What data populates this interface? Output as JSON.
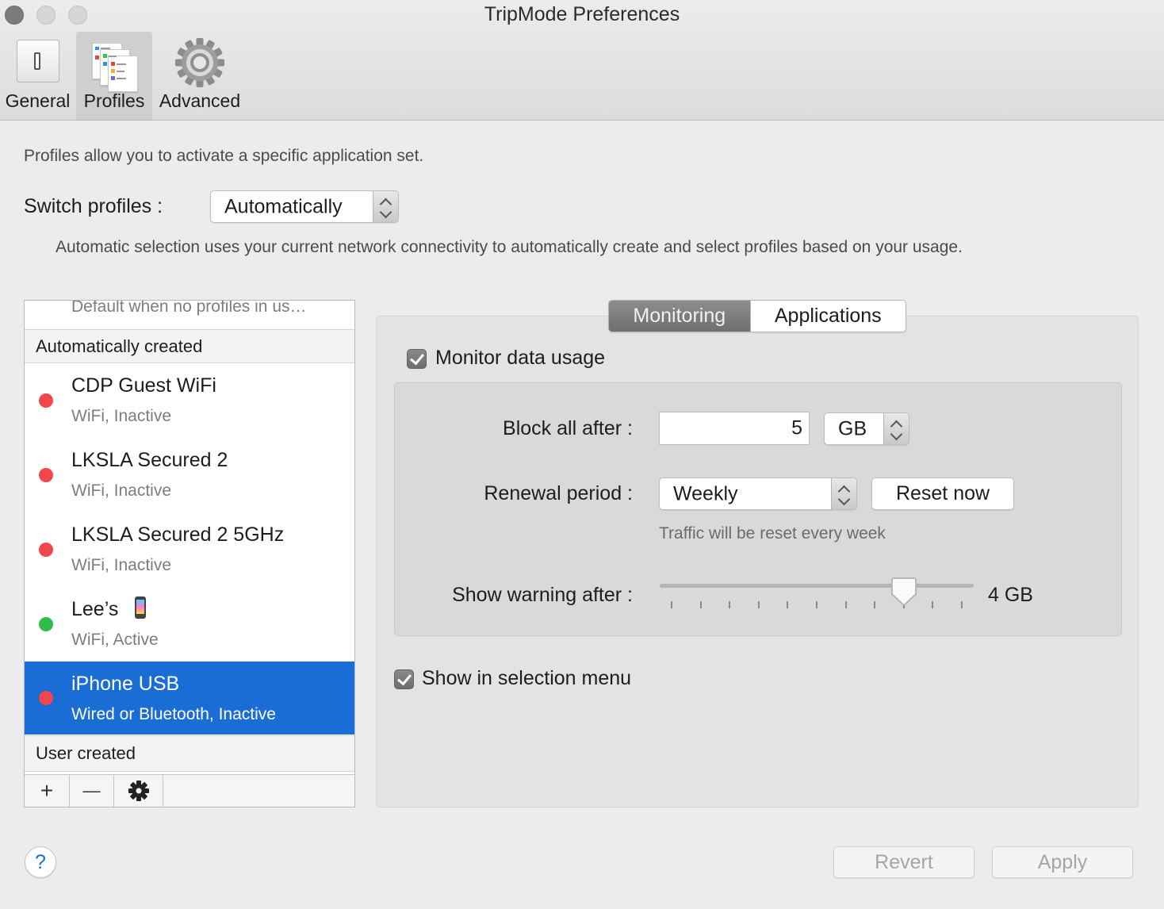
{
  "window": {
    "title": "TripMode Preferences"
  },
  "toolbar": {
    "items": [
      {
        "label": "General",
        "icon": "switch-icon"
      },
      {
        "label": "Profiles",
        "icon": "profiles-icon"
      },
      {
        "label": "Advanced",
        "icon": "gear-icon"
      }
    ],
    "selected": "Profiles"
  },
  "profiles": {
    "description": "Profiles allow you to activate a specific application set.",
    "switch_label": "Switch profiles :",
    "switch_value": "Automatically",
    "auto_description": "Automatic selection uses your current network connectivity to automatically create and select profiles based on your usage."
  },
  "list": {
    "default_item": "Default when no profiles in us…",
    "group_auto": "Automatically created",
    "items": [
      {
        "title": "CDP Guest WiFi",
        "subtitle": "WiFi, Inactive",
        "status_color": "#f2474a"
      },
      {
        "title": "LKSLA Secured 2",
        "subtitle": "WiFi, Inactive",
        "status_color": "#f2474a"
      },
      {
        "title": "LKSLA Secured 2 5GHz",
        "subtitle": "WiFi, Inactive",
        "status_color": "#f2474a"
      },
      {
        "title": "Lee’s",
        "subtitle": "WiFi, Active",
        "status_color": "#2fbd4a",
        "icon": "phone-icon"
      },
      {
        "title": "iPhone USB",
        "subtitle": "Wired or Bluetooth, Inactive",
        "status_color": "#f2474a",
        "selected": true
      }
    ],
    "group_user": "User created",
    "footer": {
      "add": "+",
      "remove": "—"
    }
  },
  "tabs": {
    "monitoring": "Monitoring",
    "applications": "Applications",
    "active": "Monitoring"
  },
  "monitor": {
    "monitor_label": "Monitor data usage",
    "monitor_checked": true,
    "block_label": "Block all after :",
    "block_value": "5",
    "block_unit": "GB",
    "renewal_label": "Renewal period :",
    "renewal_value": "Weekly",
    "reset_label": "Reset now",
    "renewal_hint": "Traffic will be reset every week",
    "warning_label": "Show warning after :",
    "warning_value": "4 GB",
    "warning_slider_fraction": 0.8,
    "show_menu_label": "Show in selection menu",
    "show_menu_checked": true
  },
  "footer": {
    "help": "?",
    "revert": "Revert",
    "apply": "Apply"
  },
  "colors": {
    "selection": "#1b6dd6",
    "inactive_dot": "#f2474a",
    "active_dot": "#2fbd4a"
  }
}
